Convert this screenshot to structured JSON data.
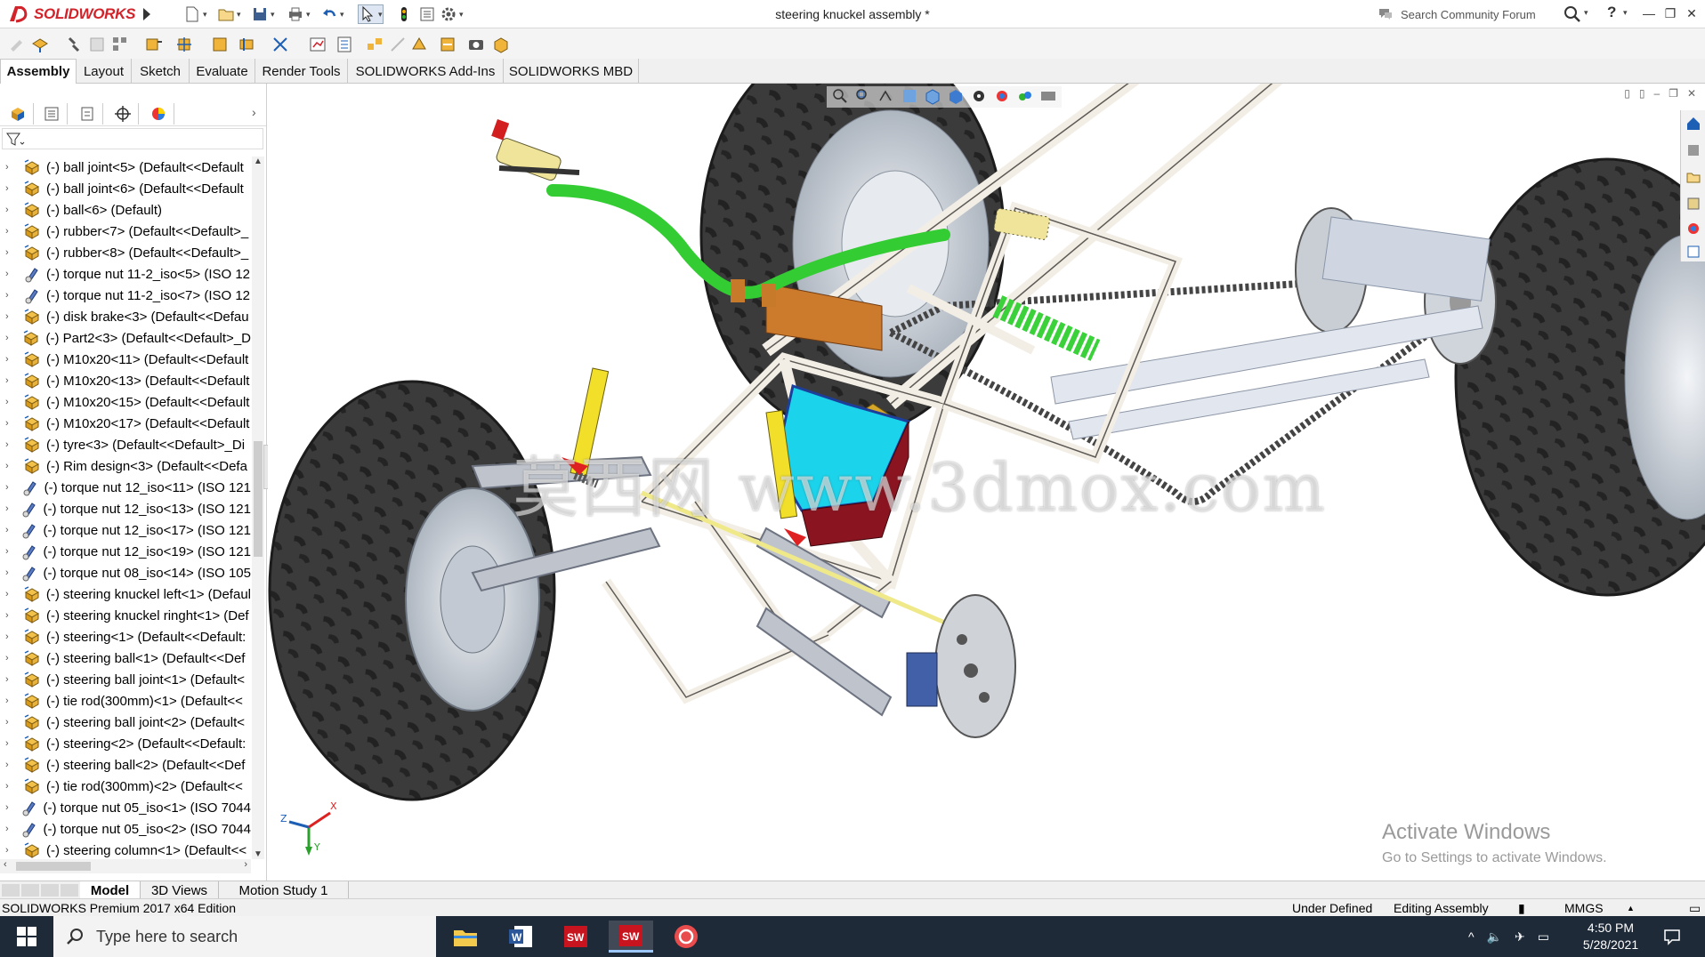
{
  "app": {
    "brand": "SOLIDWORKS",
    "document_title": "steering knuckel assembly *",
    "community_search_placeholder": "Search Community Forum",
    "help_label": "?"
  },
  "command_tabs": [
    "Assembly",
    "Layout",
    "Sketch",
    "Evaluate",
    "Render Tools",
    "SOLIDWORKS Add-Ins",
    "SOLIDWORKS MBD"
  ],
  "active_command_tab": "Assembly",
  "feature_tree": [
    {
      "label": "(-) ball joint<5> (Default<<Default",
      "icon": "part-icon"
    },
    {
      "label": "(-) ball joint<6> (Default<<Default",
      "icon": "part-icon"
    },
    {
      "label": "(-) ball<6> (Default)",
      "icon": "part-icon"
    },
    {
      "label": "(-) rubber<7> (Default<<Default>_",
      "icon": "part-icon"
    },
    {
      "label": "(-) rubber<8> (Default<<Default>_",
      "icon": "part-icon"
    },
    {
      "label": "(-) torque nut 11-2_iso<5> (ISO 12",
      "icon": "toolbox-part-icon"
    },
    {
      "label": "(-) torque nut 11-2_iso<7> (ISO 12",
      "icon": "toolbox-part-icon"
    },
    {
      "label": "(-) disk brake<3> (Default<<Defau",
      "icon": "part-icon"
    },
    {
      "label": "(-) Part2<3> (Default<<Default>_D",
      "icon": "part-icon"
    },
    {
      "label": "(-) M10x20<11> (Default<<Default",
      "icon": "part-icon"
    },
    {
      "label": "(-) M10x20<13> (Default<<Default",
      "icon": "part-icon"
    },
    {
      "label": "(-) M10x20<15> (Default<<Default",
      "icon": "part-icon"
    },
    {
      "label": "(-) M10x20<17> (Default<<Default",
      "icon": "part-icon"
    },
    {
      "label": "(-) tyre<3> (Default<<Default>_Di",
      "icon": "part-icon"
    },
    {
      "label": "(-) Rim design<3> (Default<<Defa",
      "icon": "part-icon"
    },
    {
      "label": "(-) torque nut 12_iso<11> (ISO 121",
      "icon": "toolbox-part-icon"
    },
    {
      "label": "(-) torque nut 12_iso<13> (ISO 121",
      "icon": "toolbox-part-icon"
    },
    {
      "label": "(-) torque nut 12_iso<17> (ISO 121",
      "icon": "toolbox-part-icon"
    },
    {
      "label": "(-) torque nut 12_iso<19> (ISO 121",
      "icon": "toolbox-part-icon"
    },
    {
      "label": "(-) torque nut 08_iso<14> (ISO 105",
      "icon": "toolbox-part-icon"
    },
    {
      "label": "(-) steering knuckel left<1> (Defaul",
      "icon": "part-icon"
    },
    {
      "label": "(-) steering knuckel ringht<1> (Def",
      "icon": "part-icon"
    },
    {
      "label": "(-) steering<1> (Default<<Default:",
      "icon": "part-icon"
    },
    {
      "label": "(-) steering ball<1> (Default<<Def",
      "icon": "part-icon"
    },
    {
      "label": "(-) steering ball joint<1> (Default<",
      "icon": "part-icon"
    },
    {
      "label": "(-) tie rod(300mm)<1> (Default<<",
      "icon": "part-icon"
    },
    {
      "label": "(-) steering ball joint<2> (Default<",
      "icon": "part-icon"
    },
    {
      "label": "(-) steering<2> (Default<<Default:",
      "icon": "part-icon"
    },
    {
      "label": "(-) steering ball<2> (Default<<Def",
      "icon": "part-icon"
    },
    {
      "label": "(-) tie rod(300mm)<2> (Default<<",
      "icon": "part-icon"
    },
    {
      "label": "(-) torque nut 05_iso<1> (ISO 7044",
      "icon": "toolbox-part-icon"
    },
    {
      "label": "(-) torque nut 05_iso<2> (ISO 7044",
      "icon": "toolbox-part-icon"
    },
    {
      "label": "(-) steering column<1> (Default<<",
      "icon": "part-icon"
    }
  ],
  "viewport": {
    "watermark": "莫西网 www.3dmox.com",
    "activate_heading": "Activate Windows",
    "activate_sub": "Go to Settings to activate Windows.",
    "triad_labels": {
      "z": "Z",
      "x": "X",
      "y": "Y"
    }
  },
  "model_tabs": [
    "Model",
    "3D Views",
    "Motion Study 1"
  ],
  "active_model_tab": "Model",
  "status": {
    "edition": "SOLIDWORKS Premium 2017 x64 Edition",
    "definition": "Under Defined",
    "mode": "Editing Assembly",
    "units": "MMGS"
  },
  "taskbar": {
    "search_placeholder": "Type here to search",
    "time": "4:50 PM",
    "date": "5/28/2021"
  },
  "colors": {
    "brand_red": "#d2232a",
    "frame": "#f2ede4",
    "handlebar": "#33cc33",
    "tyre": "#3c3c3c",
    "rim": "#d6dbe2",
    "battery": "#22cfe6",
    "shock_yellow": "#f1df2a",
    "taskbar": "#1f2a38"
  }
}
